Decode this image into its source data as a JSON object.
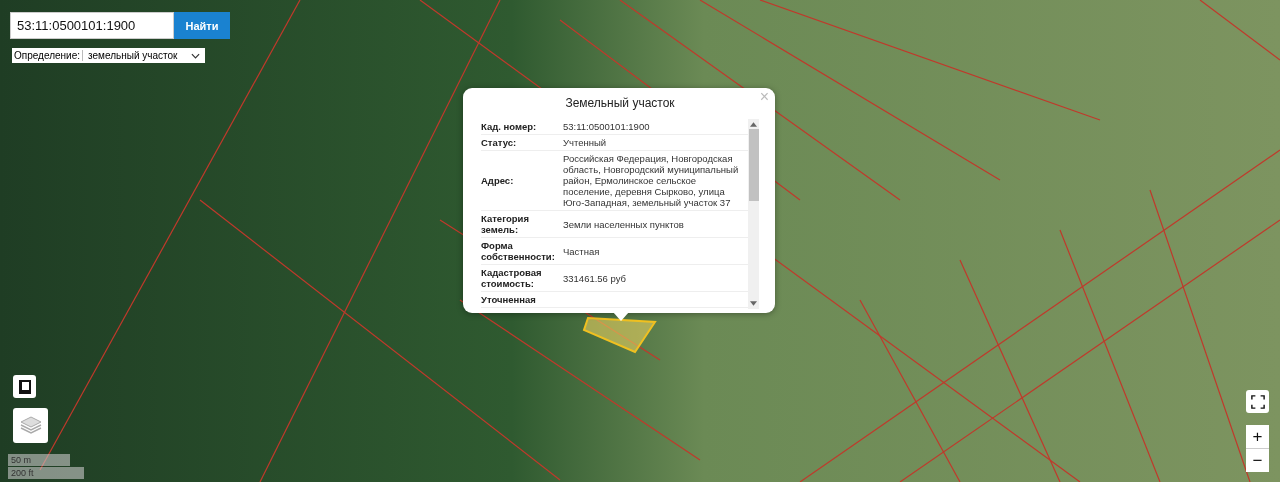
{
  "search": {
    "value": "53:11:0500101:1900",
    "button": "Найти"
  },
  "definition": {
    "label": "Определение:",
    "value": "земельный участок"
  },
  "popup": {
    "title": "Земельный участок",
    "close": "×",
    "rows": [
      {
        "label": "Кад. номер:",
        "value": "53:11:0500101:1900"
      },
      {
        "label": "Статус:",
        "value": "Учтенный"
      },
      {
        "label": "Адрес:",
        "value": "Российская Федерация, Новгородская область, Новгородский муниципальный район, Ермолинское сельское поселение, деревня Сырково, улица Юго-Западная, земельный участок 37"
      },
      {
        "label": "Категория земель:",
        "value": "Земли населенных пунктов"
      },
      {
        "label": "Форма собственности:",
        "value": "Частная"
      },
      {
        "label": "Кадастровая стоимость:",
        "value": "331461.56 руб"
      },
      {
        "label": "Уточненная"
      }
    ]
  },
  "scale": [
    "50 m",
    "200 ft"
  ],
  "zoom": {
    "in": "+",
    "out": "−"
  }
}
